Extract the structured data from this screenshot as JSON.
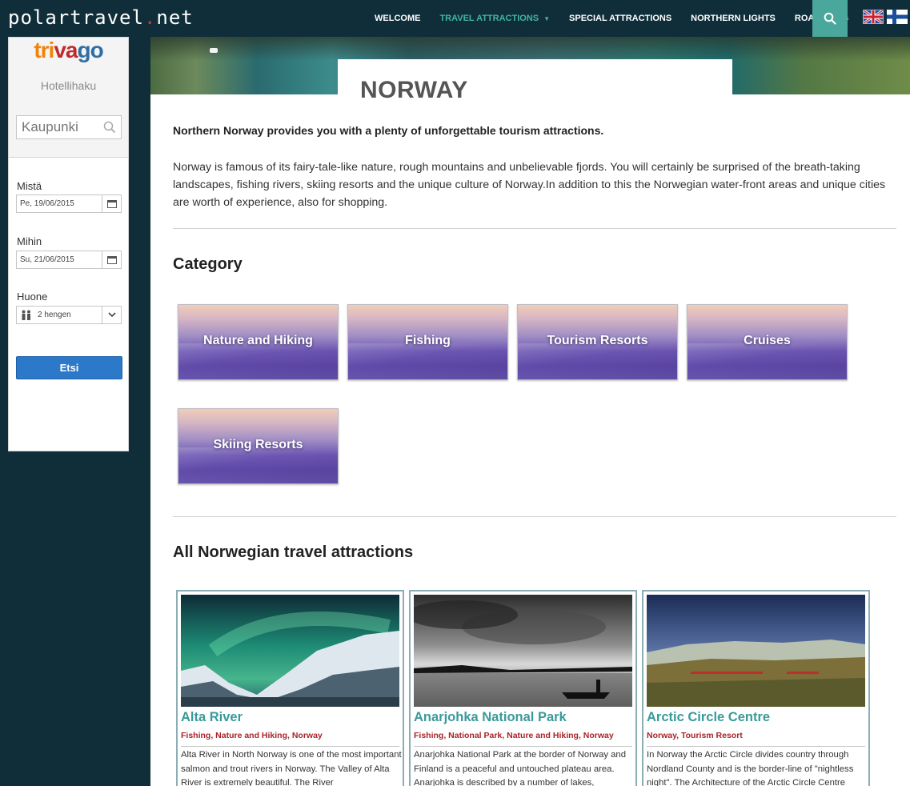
{
  "brand": {
    "name_part1": "polartravel",
    "dot": ".",
    "name_part2": "net"
  },
  "nav": {
    "items": [
      {
        "label": "WELCOME"
      },
      {
        "label": "TRAVEL ATTRACTIONS",
        "active": true
      },
      {
        "label": "SPECIAL ATTRACTIONS"
      },
      {
        "label": "NORTHERN LIGHTS"
      },
      {
        "label": "ROAD MAPS"
      }
    ],
    "search_icon": "search-icon",
    "flags": [
      "uk-flag-icon",
      "finland-flag-icon"
    ],
    "colors": {
      "bar": "#0f2e3a",
      "active": "#42b4a6",
      "search_bg": "#4aa79c"
    }
  },
  "hotel_widget": {
    "logo": {
      "t1": "tri",
      "t2": "va",
      "t3": "go"
    },
    "title": "Hotellihaku",
    "city_placeholder": "Kaupunki",
    "from_label": "Mistä",
    "from_value": "Pe, 19/06/2015",
    "to_label": "Mihin",
    "to_value": "Su, 21/06/2015",
    "room_label": "Huone",
    "room_value": "2 hengen",
    "search_button": "Etsi",
    "icons": [
      "search-icon",
      "calendar-icon",
      "people-icon",
      "chevron-down-icon"
    ]
  },
  "page": {
    "title": "NORWAY",
    "lead": "Northern Norway provides you with a plenty of unforgettable tourism attractions.",
    "intro": "Norway is famous of its fairy-tale-like nature, rough mountains and unbelievable fjords. You will certainly be surprised of the breath-taking landscapes, fishing rivers, skiing resorts and the unique culture of Norway.In addition to this the Norwegian water-front areas and unique cities are worth of experience, also for shopping.",
    "category_heading": "Category",
    "categories": [
      {
        "label": "Nature and Hiking"
      },
      {
        "label": "Fishing"
      },
      {
        "label": "Tourism Resorts"
      },
      {
        "label": "Cruises"
      },
      {
        "label": "Skiing Resorts"
      }
    ],
    "attractions_heading": "All Norwegian travel attractions",
    "attractions": [
      {
        "title": "Alta River",
        "tags": "Fishing, Nature and Hiking, Norway",
        "text": "Alta River in North Norway is one of the most important salmon and trout rivers in Norway. The Valley of Alta River is extremely beautiful. The River"
      },
      {
        "title": "Anarjohka National Park",
        "tags": "Fishing, National Park, Nature and Hiking, Norway",
        "text": "Anarjohka National Park at the border of Norway and Finland is a peaceful and untouched plateau area. Anarjohka is described by a number of lakes,"
      },
      {
        "title": "Arctic Circle Centre",
        "tags": "Norway, Tourism Resort",
        "text": "In Norway the Arctic Circle divides country through Nordland County and is the border-line of \"nightless night\". The Architecture of the Arctic Circle Centre"
      }
    ],
    "colors": {
      "card_title": "#3a9a9a",
      "card_tags": "#a8232a",
      "card_border": "#8aaeb4"
    }
  }
}
